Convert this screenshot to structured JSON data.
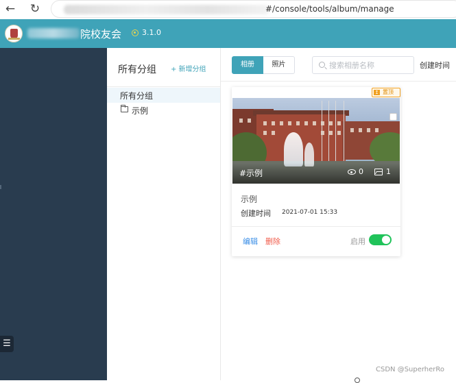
{
  "browser": {
    "back_icon": "arrow-left-icon",
    "reload_icon": "reload-icon",
    "url_visible": "#/console/tools/album/manage"
  },
  "header": {
    "org_name": "院校友会",
    "version": "3.1.0",
    "bg_color": "#3fa3b8"
  },
  "sidebar": {
    "bg_color": "#293c4f",
    "toggle_icon": "list-icon"
  },
  "groups": {
    "title": "所有分组",
    "new_group_label": "+ 新增分组",
    "items": [
      {
        "label": "所有分组",
        "selected": true
      },
      {
        "label": "示例",
        "icon": "folder-icon"
      }
    ]
  },
  "toolbar": {
    "tabs": [
      {
        "label": "相册",
        "active": true
      },
      {
        "label": "照片",
        "active": false
      }
    ],
    "search_placeholder": "搜索相册名称",
    "sort_label": "创建时间"
  },
  "albums": [
    {
      "pin_badge": "置顶",
      "cover_tag": "#示例",
      "views": "0",
      "photos": "1",
      "name": "示例",
      "created_label": "创建时间",
      "created_time": "2021-07-01 15:33",
      "edit_label": "编辑",
      "delete_label": "删除",
      "enable_label": "启用",
      "enabled": true
    }
  ],
  "watermark": "CSDN @SuperherRo",
  "colors": {
    "accent": "#3fa3b8",
    "danger": "#f15b4a",
    "link": "#3a8ee6",
    "switch_on": "#20c35a",
    "pin": "#f0a020"
  }
}
